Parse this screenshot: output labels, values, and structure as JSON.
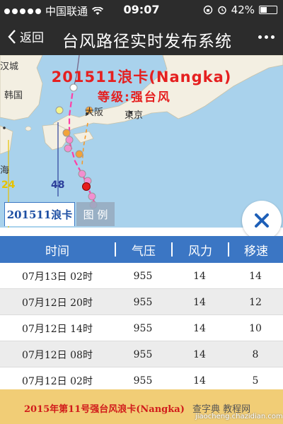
{
  "status": {
    "carrier": "中国联通",
    "time": "09:07",
    "battery": "42%",
    "battery_level": 0.42
  },
  "nav": {
    "back_label": "返回",
    "title": "台风路径实时发布系统"
  },
  "map": {
    "storm_title": "201511浪卡(Nangka)",
    "storm_level": "等级:强台风",
    "places": {
      "korea_partial": "汉城",
      "korea": "韩国",
      "osaka": "大阪",
      "tokyo": "東京",
      "sea_partial": "海"
    },
    "scale_value": "48",
    "scale_value_2": "24"
  },
  "tabs": {
    "active": "201511浪卡",
    "legend": "图 例"
  },
  "table": {
    "headers": [
      "时间",
      "气压",
      "风力",
      "移速"
    ],
    "rows": [
      {
        "time": "07月13日 02时",
        "pressure": "955",
        "wind": "14",
        "speed": "14"
      },
      {
        "time": "07月12日 20时",
        "pressure": "955",
        "wind": "14",
        "speed": "12"
      },
      {
        "time": "07月12日 14时",
        "pressure": "955",
        "wind": "14",
        "speed": "10"
      },
      {
        "time": "07月12日 08时",
        "pressure": "955",
        "wind": "14",
        "speed": "8"
      },
      {
        "time": "07月12日 02时",
        "pressure": "955",
        "wind": "14",
        "speed": "5"
      }
    ]
  },
  "footer": {
    "text": "2015年第11号强台风浪卡(Nangka)",
    "extra": "查字典 教程网",
    "url": "jiaocheng.chazidian.com"
  },
  "colors": {
    "header_blue": "#3b76c4",
    "title_red": "#e52020",
    "footer_bg": "#f1cd76"
  }
}
